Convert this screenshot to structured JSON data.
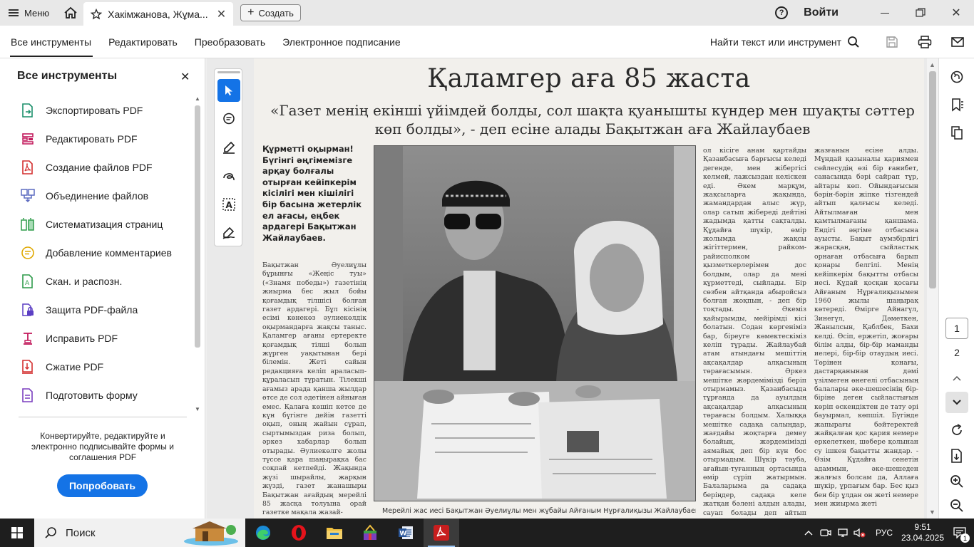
{
  "titlebar": {
    "menu_label": "Меню",
    "tab_title": "Хакімжанова, Жұма...",
    "create_label": "Создать",
    "signin_label": "Войти"
  },
  "toolbar": {
    "tabs": [
      "Все инструменты",
      "Редактировать",
      "Преобразовать",
      "Электронное подписание"
    ],
    "find_label": "Найти текст или инструмент"
  },
  "left_panel": {
    "title": "Все инструменты",
    "tools": [
      {
        "label": "Экспортировать PDF",
        "icon": "export-pdf-icon",
        "color": "#1a8f6a"
      },
      {
        "label": "Редактировать PDF",
        "icon": "edit-pdf-icon",
        "color": "#c2185b"
      },
      {
        "label": "Создание файлов PDF",
        "icon": "create-pdf-icon",
        "color": "#d32f2f"
      },
      {
        "label": "Объединение файлов",
        "icon": "combine-files-icon",
        "color": "#5c6bc0"
      },
      {
        "label": "Систематизация страниц",
        "icon": "organize-pages-icon",
        "color": "#2e9b4a"
      },
      {
        "label": "Добавление комментариев",
        "icon": "comment-icon",
        "color": "#e0a800"
      },
      {
        "label": "Скан. и распозн.",
        "icon": "scan-ocr-icon",
        "color": "#2e9b4a"
      },
      {
        "label": "Защита PDF-файла",
        "icon": "protect-pdf-icon",
        "color": "#5c3fc4"
      },
      {
        "label": "Исправить PDF",
        "icon": "fix-pdf-icon",
        "color": "#c2185b"
      },
      {
        "label": "Сжатие PDF",
        "icon": "compress-pdf-icon",
        "color": "#d32f2f"
      },
      {
        "label": "Подготовить форму",
        "icon": "prepare-form-icon",
        "color": "#7b3fbf"
      }
    ],
    "promo_text": "Конвертируйте, редактируйте и электронно подписывайте формы и соглашения PDF",
    "try_button": "Попробовать"
  },
  "newspaper": {
    "headline": "Қаламгер аға 85 жаста",
    "subhead": "«Газет менің екінші үйімдей болды, сол шақта қуанышты күндер мен шуақты сәттер көп болды», - деп есіне алады Бақытжан аға Жайлаубаев",
    "lead": "Құрметті оқырман! Бүгінгі әңгімемізге арқау болғалы отырған кейіпкерім кісілігі мен кішілігі бір басына жетерлік ел ағасы, еңбек ардагері Бақытжан Жайлаубаев.",
    "col1": "Бақытжан Әуелиұлы бұрынғы «Жеңіс туы» («Знамя победы») газетінің жиырма бес жыл бойы қоғамдық тілшісі болған газет ардагері. Бұл кісінің есімі көнекөз әулиекөлдік оқырмандарға жақсы таныс. Қаламгер ағаны ертеректе қоғамдық тілші болып жүрген уақытынан бері білемін. Жеті сайын редакцияға келіп араласып-құраласып тұратын. Тілекші ағамыз арада қанша жылдар өтсе де сол әдетінен айныған емес. Қалаға көшіп кетсе де күн бүгінге дейін газетті оқып, оның жайын сұрап, сыртымыздан риза болып, әркез хабарлар болып отырады. Әулиекөлге жолы түссе қара шаңырақка бас соқпай кетпейді. Жақында жүзі шырайлы, жарқын жүзді, газет жанашыры Бақытжан ағайдың мерейлі 85 жасқа толуына орай газетке мақала жазай-",
    "col3": "ол кісіге анам қартайды Қазанбасыға барғысы келеді дегенде, мен жібергісі келмей, лажсыздан келіскен еді. Әкем марқұм, жақсыларға жақында, жамандардан алыс жүр, олар сатып жібереді дейтіні жадымда қатты сақталды. Құдайға шүкір, өмір жолымда жақсы жігіттермен, райком-райисполком қызметкерлерімен дос болдым, олар да мені құрметтеді, сыйлады. Бір сөзбен айтқанда абыройсыз болған жоқпын, - деп бір тоқтады. - Әкеміз қайырымды, мейірімді кісі болатын. Содан көргеніміз бар, біреуге көмектескіміз келіп тұрады. Жайлаубай атам атындағы мешіттің ақсақалдар алқасының төрағасымын. Әркез мешітке жәрдемімізді беріп отырмамыз. Қазанбасыда тұрғанда да ауылдың ақсақалдар алқасының төрағасы болдым. Халыққа мешітке садақа салыңдар, жағдайы жоқтарға демеу болайық, жәрдемімізді аямайық деп бір күн бос отырмадым. Шүкір тәуба, ағайын-туғанның ортасында өмір сүріп жатырмын. Балаларыма да садақа беріңдер, садақа келе жатқан бәлені алдын алады, сауап болады деп айтып отырамын. Адамға жақсылық істеу",
    "col4": "жазғанын есіне алды. Мұндай қазыналы қариямен сөйлесудің өзі бір ғанибет, санасында бәрі сайрап тұр, айтары көп. Ойындағысын бәрін-бәрін жіпке тізгендей айтып қалғысы келеді. Айтылмаған мен қамтылмағаны қаншама. Ендігі әңгіме отбасына ауысты. Бақыт аумзбірлігі жарасқан, сыйластық орнаған отбасыға барып қонары белгілі. Менің кейіпкерім бақытты отбасы иесі. Құдай қосқан қосағы Айғаным Нұрғалиқызымен 1960 жылы шаңырақ көтереді. Өмірге Айнагүл, Зинегүл, Дәметкен, Жанылсын, Қаблбек, Бахи келді. Өсіп, ержетіп, жоғары білім алды, бір-бір маманды иелері, бір-бір отаудың иесі. Төрінен қонағы, дастарқанынан дәмі үзілмеген өнегелі отбасының балалары әке-шешесінің бір-біріне деген сыйластығын көріп өскендіктен де тату әрі бауырмал, көпшіл. Бүгінде жапырағы бәйтеректей жайқалған қос қария немере еркелеткен, шөбере қолынан су ішкен бақытты жандар. - Өзім Құдайға сенетін адаммын, әке-шешеден жалғыз болсам да, Аллаға шүкір, ұрпағым бар. Бес қыз бен бір ұлдан он жеті немере мен жиырма жеті",
    "caption": "Мерейлі жас иесі Бақытжан Әуелиұлы мен жұбайы Айғаным Нұрғалиқызы Жайлаубаевтар"
  },
  "right_rail": {
    "pages": [
      "1",
      "2"
    ]
  },
  "taskbar": {
    "search_label": "Поиск",
    "language": "РУС",
    "time": "9:51",
    "date": "23.04.2025",
    "notification_count": "1"
  }
}
